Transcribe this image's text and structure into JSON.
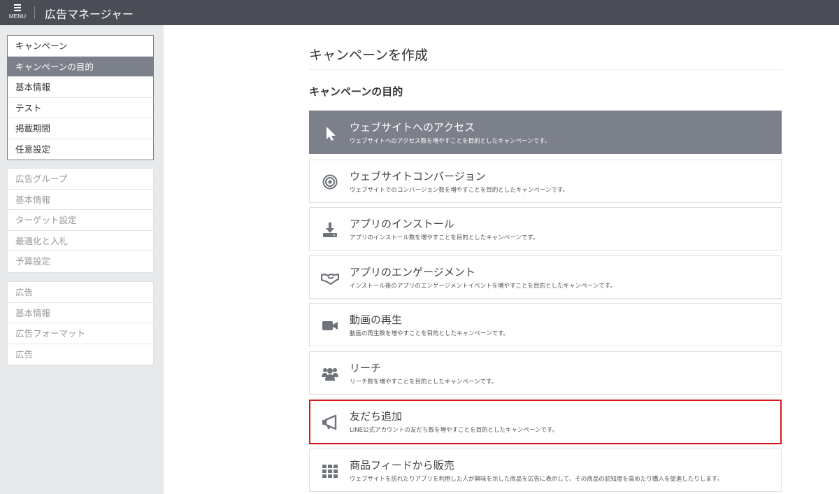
{
  "topbar": {
    "menu_label": "MENU",
    "app_title": "広告マネージャー"
  },
  "sidebar": {
    "campaign_group": [
      {
        "label": "キャンペーン"
      },
      {
        "label": "キャンペーンの目的",
        "selected": true
      },
      {
        "label": "基本情報"
      },
      {
        "label": "テスト"
      },
      {
        "label": "掲載期間"
      },
      {
        "label": "任意設定"
      }
    ],
    "adgroup_group": [
      {
        "label": "広告グループ"
      },
      {
        "label": "基本情報"
      },
      {
        "label": "ターゲット設定"
      },
      {
        "label": "最適化と入札"
      },
      {
        "label": "予算設定"
      }
    ],
    "ad_group": [
      {
        "label": "広告"
      },
      {
        "label": "基本情報"
      },
      {
        "label": "広告フォーマット"
      },
      {
        "label": "広告"
      }
    ]
  },
  "main": {
    "page_title": "キャンペーンを作成",
    "section_title": "キャンペーンの目的",
    "options": [
      {
        "icon": "cursor-icon",
        "title": "ウェブサイトへのアクセス",
        "desc": "ウェブサイトへのアクセス数を増やすことを目的としたキャンペーンです。",
        "selected": true
      },
      {
        "icon": "target-icon",
        "title": "ウェブサイトコンバージョン",
        "desc": "ウェブサイトでのコンバージョン数を増やすことを目的としたキャンペーンです。"
      },
      {
        "icon": "download-icon",
        "title": "アプリのインストール",
        "desc": "アプリのインストール数を増やすことを目的としたキャンペーンです。"
      },
      {
        "icon": "handshake-icon",
        "title": "アプリのエンゲージメント",
        "desc": "インストール後のアプリのエンゲージメントイベントを増やすことを目的としたキャンペーンです。"
      },
      {
        "icon": "video-camera-icon",
        "title": "動画の再生",
        "desc": "動画の再生数を増やすことを目的としたキャンペーンです。"
      },
      {
        "icon": "users-icon",
        "title": "リーチ",
        "desc": "リーチ数を増やすことを目的としたキャンペーンです。"
      },
      {
        "icon": "megaphone-icon",
        "title": "友だち追加",
        "desc": "LINE公式アカウントの友だち数を増やすことを目的としたキャンペーンです。",
        "highlighted": true
      },
      {
        "icon": "grid-icon",
        "title": "商品フィードから販売",
        "desc": "ウェブサイトを訪れたりアプリを利用した人が興味を示した商品を広告に表示して、その商品の認知度を高めたり購入を促進したりします。"
      }
    ]
  },
  "colors": {
    "topbar": "#4a4d55",
    "selected": "#7c808a",
    "highlight_border": "#d7191c",
    "sidebar_bg": "#e8e9eb",
    "icon": "#6f737b"
  }
}
